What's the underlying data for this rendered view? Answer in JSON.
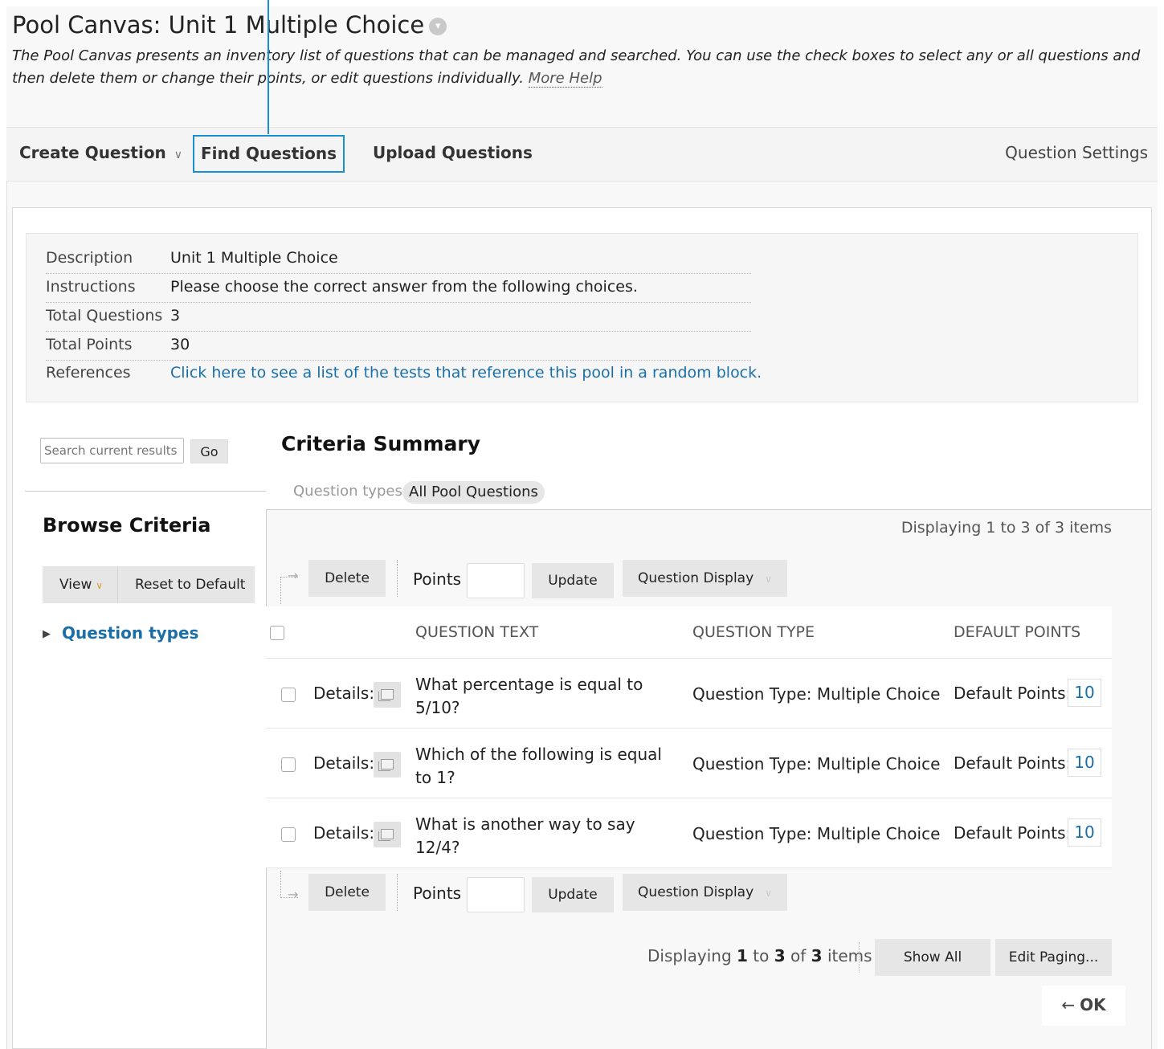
{
  "page": {
    "title": "Pool Canvas: Unit 1 Multiple Choice",
    "title_badge_icon": "chevron-down-circle-icon",
    "intro": "The Pool Canvas presents an inventory list of questions that can be managed and searched. You can use the check boxes to select any or all questions and then delete them or change their points, or edit questions individually.",
    "more_help": "More Help",
    "highlight_color": "#1a8fd0"
  },
  "actionbar": {
    "create_question": "Create Question",
    "find_questions": "Find Questions",
    "upload_questions": "Upload Questions",
    "question_settings": "Question Settings"
  },
  "info": {
    "description_label": "Description",
    "description_value": "Unit 1 Multiple Choice",
    "instructions_label": "Instructions",
    "instructions_value": "Please choose the correct answer from the following choices.",
    "total_questions_label": "Total Questions",
    "total_questions_value": "3",
    "total_points_label": "Total Points",
    "total_points_value": "30",
    "references_label": "References",
    "references_link": "Click here to see a list of the tests that reference this pool in a random block."
  },
  "sidebar": {
    "search_placeholder": "Search current results",
    "go": "Go",
    "browse_title": "Browse Criteria",
    "view": "View",
    "reset": "Reset to Default",
    "question_types": "Question types"
  },
  "criteria": {
    "title": "Criteria Summary",
    "label": "Question types",
    "pill": "All Pool Questions"
  },
  "listing": {
    "displaying_top": "Displaying 1 to 3 of 3 items",
    "delete": "Delete",
    "points": "Points",
    "update": "Update",
    "question_display": "Question Display",
    "headers": {
      "text": "QUESTION TEXT",
      "type": "QUESTION TYPE",
      "points": "DEFAULT POINTS"
    },
    "rows": [
      {
        "details": "Details:",
        "text": "What percentage is equal to 5/10?",
        "type": "Question Type: Multiple Choice",
        "points_label": "Default Points:",
        "points": "10"
      },
      {
        "details": "Details:",
        "text": "Which of the following is equal to 1?",
        "type": "Question Type: Multiple Choice",
        "points_label": "Default Points:",
        "points": "10"
      },
      {
        "details": "Details:",
        "text": "What is another way to say 12/4?",
        "type": "Question Type: Multiple Choice",
        "points_label": "Default Points:",
        "points": "10"
      }
    ],
    "bottom": {
      "displaying": "Displaying",
      "from": "1",
      "to_word": "to",
      "to": "3",
      "of_word": "of",
      "total": "3",
      "items": "items",
      "show_all": "Show All",
      "edit_paging": "Edit Paging...",
      "ok": "OK"
    }
  }
}
